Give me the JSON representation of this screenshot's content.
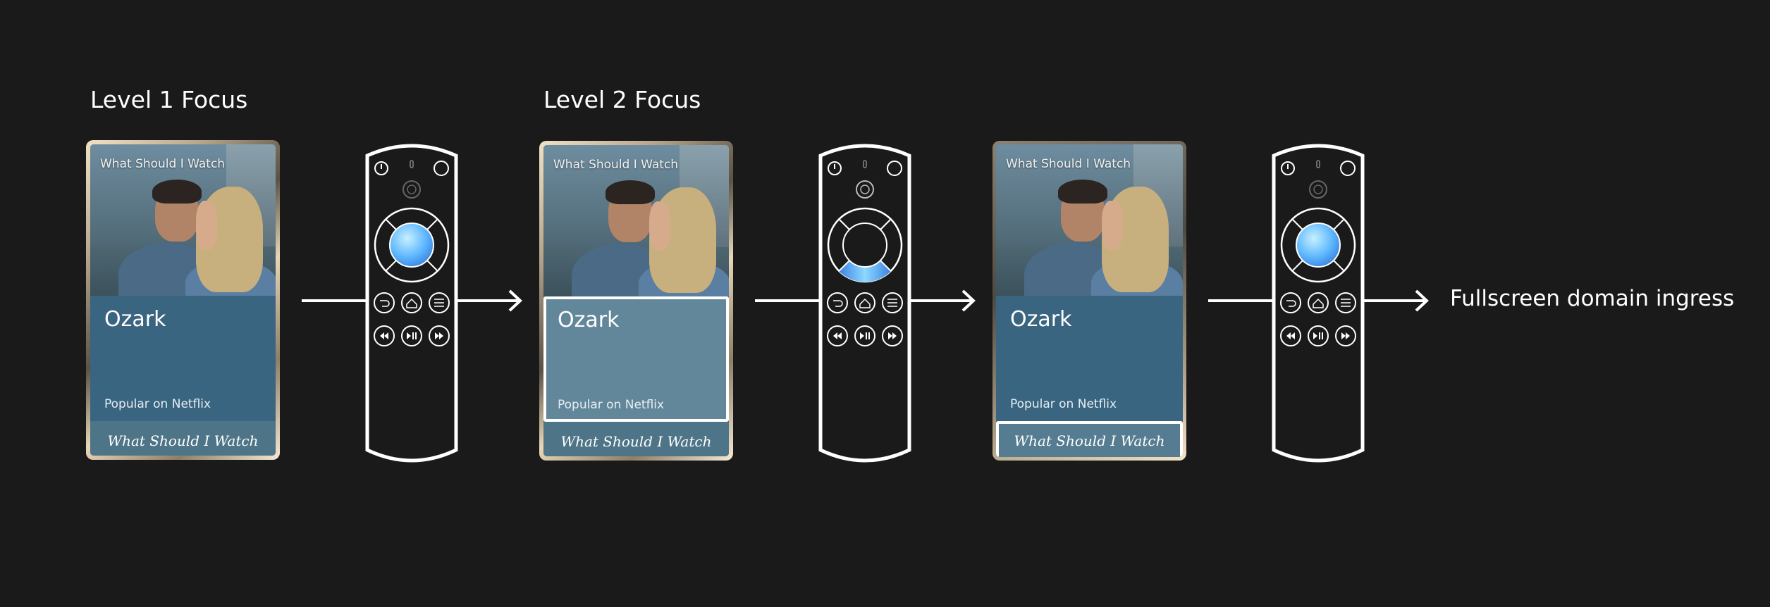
{
  "labels": {
    "level1": "Level 1 Focus",
    "level2": "Level 2 Focus",
    "destination": "Fullscreen domain ingress"
  },
  "card": {
    "photo_title": "What Should I Watch",
    "show_title": "Ozark",
    "subtitle": "Popular on Netflix",
    "footer": "What Should I Watch"
  },
  "states": [
    {
      "label": "level1",
      "focus": "card",
      "remote_highlight": "center"
    },
    {
      "label": "level2",
      "focus": "info",
      "remote_highlight": "down"
    },
    {
      "label": "",
      "focus": "footer",
      "remote_highlight": "center"
    }
  ],
  "colors": {
    "background": "#1a1a1a",
    "remote_outline": "#ffffff",
    "highlight": "#4fb3ff",
    "card_panel": "#3a6580",
    "card_panel_focused": "#63879a"
  },
  "icons": [
    "power-icon",
    "mic-icon",
    "settings-icon",
    "alexa-icon",
    "back-icon",
    "home-icon",
    "menu-icon",
    "rewind-icon",
    "play-pause-icon",
    "fast-forward-icon",
    "arrow-right-icon"
  ]
}
